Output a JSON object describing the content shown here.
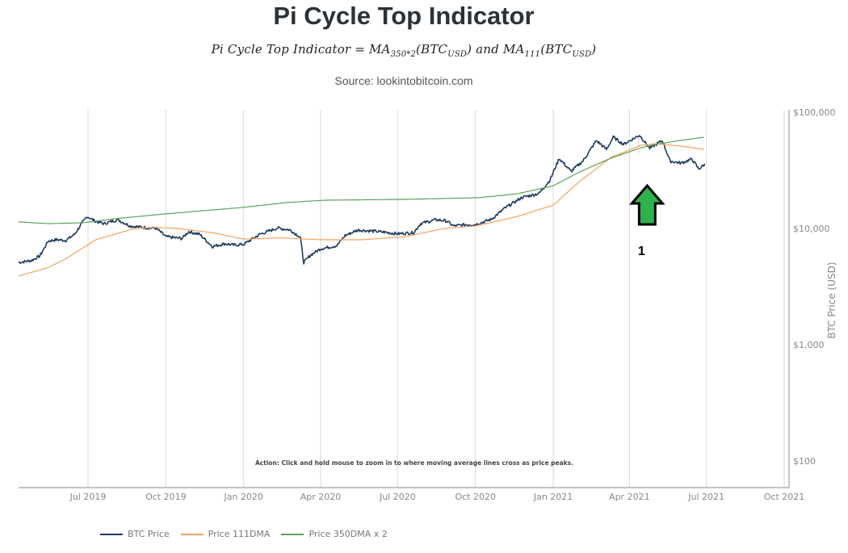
{
  "header": {
    "title": "Pi Cycle Top Indicator",
    "formula": {
      "lhs": "Pi Cycle Top Indicator = ",
      "ma1": "MA",
      "ma1_sub": "350*2",
      "ma1_arg": "(BTC",
      "ma1_arg_sub": "USD",
      "ma1_close": ")",
      "and": " and ",
      "ma2": "MA",
      "ma2_sub": "111",
      "ma2_arg": "(BTC",
      "ma2_arg_sub": "USD",
      "ma2_close": ")"
    },
    "source": "Source: lookintobitcoin.com"
  },
  "colors": {
    "btc": "#1f3b5c",
    "ma111": "#f5a25d",
    "ma350x2": "#5aa35a",
    "arrow_fill": "#2fb24c",
    "arrow_stroke": "#000000",
    "grid": "#d8d8d8",
    "axis": "#888888",
    "cross_marker": "#f3a0a8"
  },
  "chart_data": {
    "type": "line",
    "title": "Pi Cycle Top Indicator",
    "xlabel": "",
    "ylabel": "BTC Price (USD)",
    "yscale": "log",
    "ylim": [
      60,
      100000
    ],
    "xlim": [
      "2019-04-10",
      "2021-10-15"
    ],
    "x_ticks": [
      "Jul 2019",
      "Oct 2019",
      "Jan 2020",
      "Apr 2020",
      "Jul 2020",
      "Oct 2020",
      "Jan 2021",
      "Apr 2021",
      "Jul 2021",
      "Oct 2021"
    ],
    "x_tick_dates": [
      "2019-07-01",
      "2019-10-01",
      "2020-01-01",
      "2020-04-01",
      "2020-07-01",
      "2020-10-01",
      "2021-01-01",
      "2021-04-01",
      "2021-07-01",
      "2021-10-01"
    ],
    "y_ticks": [
      100,
      1000,
      10000,
      100000
    ],
    "y_tick_labels": [
      "$100",
      "$1,000",
      "$10,000",
      "$100,000"
    ],
    "y_axis_side": "right",
    "grid": "vertical",
    "legend_position": "bottom-left",
    "series": [
      {
        "name": "BTC Price",
        "color_key": "btc",
        "points": [
          [
            "2019-04-10",
            5100
          ],
          [
            "2019-04-25",
            5300
          ],
          [
            "2019-05-05",
            5800
          ],
          [
            "2019-05-15",
            7800
          ],
          [
            "2019-05-25",
            8000
          ],
          [
            "2019-06-05",
            7900
          ],
          [
            "2019-06-15",
            8900
          ],
          [
            "2019-06-25",
            11400
          ],
          [
            "2019-06-30",
            12700
          ],
          [
            "2019-07-10",
            11500
          ],
          [
            "2019-07-20",
            11000
          ],
          [
            "2019-08-05",
            11900
          ],
          [
            "2019-08-20",
            10500
          ],
          [
            "2019-09-05",
            10200
          ],
          [
            "2019-09-20",
            10000
          ],
          [
            "2019-10-01",
            8500
          ],
          [
            "2019-10-20",
            8200
          ],
          [
            "2019-10-28",
            9400
          ],
          [
            "2019-11-10",
            8900
          ],
          [
            "2019-11-25",
            7000
          ],
          [
            "2019-12-10",
            7400
          ],
          [
            "2019-12-20",
            7200
          ],
          [
            "2020-01-01",
            7300
          ],
          [
            "2020-01-20",
            8900
          ],
          [
            "2020-02-10",
            10100
          ],
          [
            "2020-02-25",
            9700
          ],
          [
            "2020-03-08",
            8400
          ],
          [
            "2020-03-12",
            5100
          ],
          [
            "2020-03-20",
            5900
          ],
          [
            "2020-04-01",
            6700
          ],
          [
            "2020-04-20",
            7100
          ],
          [
            "2020-04-30",
            8700
          ],
          [
            "2020-05-15",
            9700
          ],
          [
            "2020-06-01",
            9500
          ],
          [
            "2020-06-15",
            9300
          ],
          [
            "2020-07-01",
            9000
          ],
          [
            "2020-07-20",
            9200
          ],
          [
            "2020-07-28",
            11000
          ],
          [
            "2020-08-15",
            11900
          ],
          [
            "2020-08-28",
            11600
          ],
          [
            "2020-09-05",
            10500
          ],
          [
            "2020-09-20",
            10800
          ],
          [
            "2020-10-01",
            10800
          ],
          [
            "2020-10-20",
            12000
          ],
          [
            "2020-11-05",
            15000
          ],
          [
            "2020-11-25",
            18500
          ],
          [
            "2020-12-15",
            20000
          ],
          [
            "2020-12-28",
            26000
          ],
          [
            "2021-01-08",
            40000
          ],
          [
            "2021-01-22",
            31000
          ],
          [
            "2021-02-05",
            38000
          ],
          [
            "2021-02-21",
            57000
          ],
          [
            "2021-03-05",
            48000
          ],
          [
            "2021-03-13",
            61000
          ],
          [
            "2021-03-25",
            53000
          ],
          [
            "2021-04-13",
            63500
          ],
          [
            "2021-04-25",
            49000
          ],
          [
            "2021-05-10",
            57000
          ],
          [
            "2021-05-19",
            38000
          ],
          [
            "2021-06-01",
            36500
          ],
          [
            "2021-06-14",
            39500
          ],
          [
            "2021-06-22",
            32500
          ],
          [
            "2021-06-29",
            35500
          ]
        ]
      },
      {
        "name": "Price 111DMA",
        "color_key": "ma111",
        "points": [
          [
            "2019-04-10",
            3900
          ],
          [
            "2019-05-15",
            4600
          ],
          [
            "2019-06-05",
            5500
          ],
          [
            "2019-07-10",
            8000
          ],
          [
            "2019-08-25",
            10000
          ],
          [
            "2019-09-20",
            10200
          ],
          [
            "2019-10-15",
            10000
          ],
          [
            "2019-11-25",
            9200
          ],
          [
            "2020-01-01",
            8100
          ],
          [
            "2020-02-15",
            8300
          ],
          [
            "2020-04-01",
            8000
          ],
          [
            "2020-05-20",
            8000
          ],
          [
            "2020-07-10",
            8500
          ],
          [
            "2020-08-25",
            10000
          ],
          [
            "2020-10-01",
            10500
          ],
          [
            "2020-11-20",
            12700
          ],
          [
            "2021-01-01",
            15900
          ],
          [
            "2021-02-01",
            25300
          ],
          [
            "2021-03-10",
            40900
          ],
          [
            "2021-04-15",
            51900
          ],
          [
            "2021-05-01",
            53700
          ],
          [
            "2021-06-01",
            51100
          ],
          [
            "2021-06-29",
            47900
          ]
        ]
      },
      {
        "name": "Price 350DMA x 2",
        "color_key": "ma350x2",
        "points": [
          [
            "2019-04-10",
            11400
          ],
          [
            "2019-05-15",
            11000
          ],
          [
            "2019-06-25",
            11200
          ],
          [
            "2019-08-10",
            12300
          ],
          [
            "2019-09-28",
            13300
          ],
          [
            "2020-01-01",
            15200
          ],
          [
            "2020-02-20",
            16700
          ],
          [
            "2020-04-05",
            17500
          ],
          [
            "2020-07-10",
            17800
          ],
          [
            "2020-10-05",
            18400
          ],
          [
            "2020-11-20",
            19900
          ],
          [
            "2021-01-01",
            23300
          ],
          [
            "2021-02-01",
            30600
          ],
          [
            "2021-03-10",
            40200
          ],
          [
            "2021-04-15",
            49500
          ],
          [
            "2021-05-01",
            52800
          ],
          [
            "2021-06-01",
            57300
          ],
          [
            "2021-06-29",
            61000
          ]
        ]
      }
    ],
    "annotations": [
      {
        "type": "arrow",
        "direction": "up",
        "date": "2021-04-22",
        "label": "1"
      },
      {
        "type": "text",
        "text": "Action: Click and hold mouse to zoom in to where moving average lines cross as price peaks."
      }
    ]
  },
  "legend": {
    "items": [
      {
        "label": "BTC Price",
        "color_key": "btc"
      },
      {
        "label": "Price 111DMA",
        "color_key": "ma111"
      },
      {
        "label": "Price 350DMA x 2",
        "color_key": "ma350x2"
      }
    ]
  }
}
